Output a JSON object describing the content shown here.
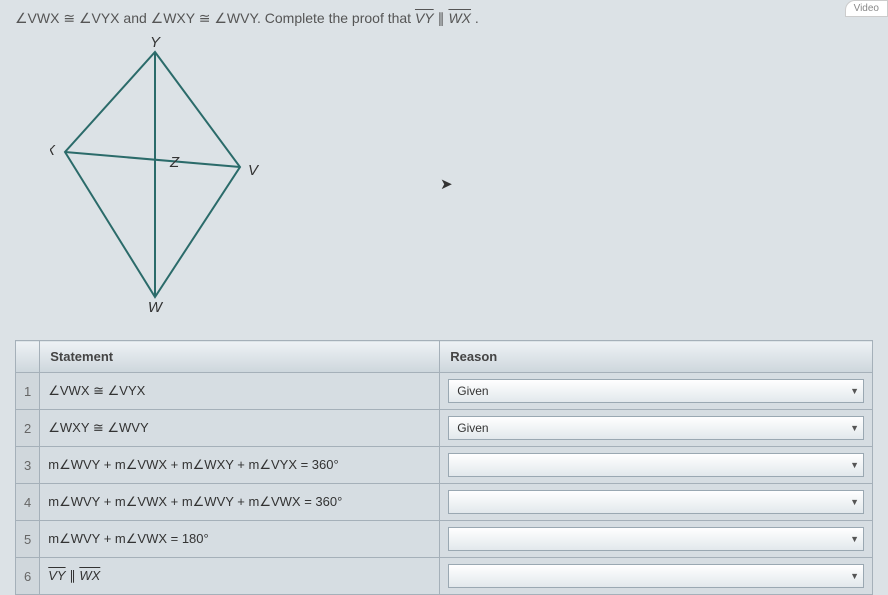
{
  "header": {
    "video_label": "Video"
  },
  "prompt": {
    "part1": "∠VWX ≅ ∠VYX and ∠WXY ≅ ∠WVY. Complete the proof that ",
    "vy": "VY",
    "parallel": " ∥ ",
    "wx": "WX",
    "end": "."
  },
  "figure": {
    "labels": {
      "Y": "Y",
      "X": "X",
      "Z": "Z",
      "V": "V",
      "W": "W"
    }
  },
  "table": {
    "header_statement": "Statement",
    "header_reason": "Reason",
    "rows": [
      {
        "n": "1",
        "stmt": "∠VWX ≅ ∠VYX",
        "reason": "Given"
      },
      {
        "n": "2",
        "stmt": "∠WXY ≅ ∠WVY",
        "reason": "Given"
      },
      {
        "n": "3",
        "stmt": "m∠WVY + m∠VWX + m∠WXY + m∠VYX = 360°",
        "reason": ""
      },
      {
        "n": "4",
        "stmt": "m∠WVY + m∠VWX + m∠WVY + m∠VWX = 360°",
        "reason": ""
      },
      {
        "n": "5",
        "stmt": "m∠WVY + m∠VWX = 180°",
        "reason": ""
      },
      {
        "n": "6",
        "stmt_html": true,
        "vy": "VY",
        "par": " ∥ ",
        "wx": "WX",
        "reason": ""
      }
    ]
  }
}
